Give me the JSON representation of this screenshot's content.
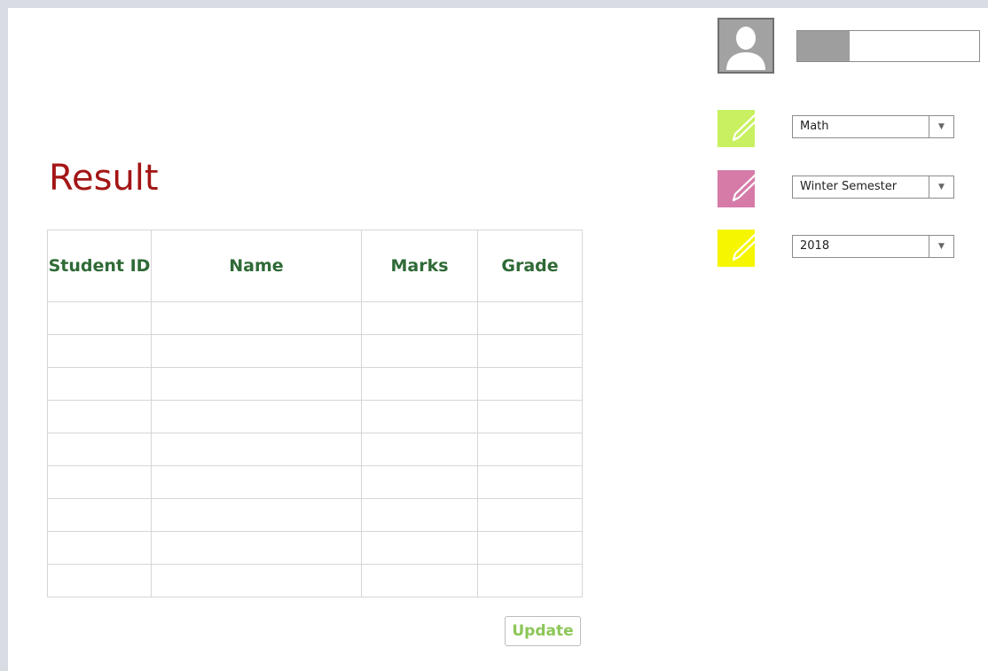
{
  "page": {
    "title": "Result"
  },
  "table": {
    "headers": {
      "student_id": "Student ID",
      "name": "Name",
      "marks": "Marks",
      "grade": "Grade"
    },
    "rows": [
      [
        "",
        "",
        "",
        ""
      ],
      [
        "",
        "",
        "",
        ""
      ],
      [
        "",
        "",
        "",
        ""
      ],
      [
        "",
        "",
        "",
        ""
      ],
      [
        "",
        "",
        "",
        ""
      ],
      [
        "",
        "",
        "",
        ""
      ],
      [
        "",
        "",
        "",
        ""
      ],
      [
        "",
        "",
        "",
        ""
      ],
      [
        "",
        "",
        "",
        ""
      ]
    ]
  },
  "actions": {
    "update_label": "Update"
  },
  "profile": {
    "avatar_icon": "user-silhouette-icon",
    "progress_fraction": 0.29
  },
  "filters": {
    "subject": {
      "value": "Math",
      "color": "#c8f060"
    },
    "semester": {
      "value": "Winter Semester",
      "color": "#d67ba8"
    },
    "year": {
      "value": "2018",
      "color": "#f6f600"
    }
  },
  "colors": {
    "title": "#a31515",
    "header_text": "#2f6a36",
    "update_text": "#8cc657"
  }
}
